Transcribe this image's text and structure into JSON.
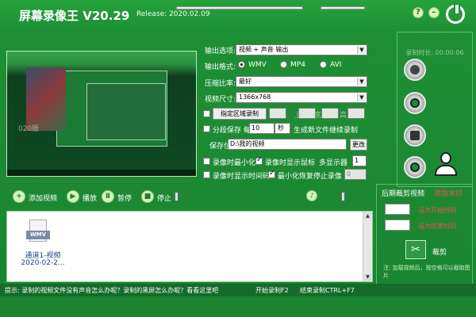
{
  "app": {
    "title": "屏幕录像王 V20.29",
    "release": "Release: 2020.02.09",
    "help_glyph": "?",
    "minimize_glyph": "–"
  },
  "preview": {
    "watermark": "020版"
  },
  "settings": {
    "output_option_label": "输出选项:",
    "output_option_value": "视频 + 声音 输出",
    "output_format_label": "输出格式:",
    "formats": [
      "WMV",
      "MP4",
      "AVI"
    ],
    "selected_format": "WMV",
    "compression_label": "压缩比率:",
    "compression_value": "最好",
    "size_label": "视频尺寸:",
    "size_value": "1366x768",
    "region_button": "指定区域录制",
    "region_left": "左",
    "region_top": "上",
    "region_width": "宽",
    "region_height": "高",
    "segment_label": "分段保存 每",
    "segment_value": "10",
    "segment_unit": "秒",
    "segment_suffix": "生成新文件继续录制",
    "save_label": "保存位置",
    "save_path": "D:\\我的视频",
    "change_button": "更改",
    "minimize_on_record": "录像时最小化",
    "show_cursor": "录像时显示鼠标",
    "multi_display": "多显示器",
    "multi_display_value": "1",
    "show_timecode": "录像时显示时间码",
    "minimize_restore_stop": "最小化恢复停止录像",
    "restore_value": "0"
  },
  "record_panel": {
    "time_label": "录制时长: 00:00:06"
  },
  "toolbar": {
    "add_video": "添加视频",
    "play": "播放",
    "pause": "暂停",
    "stop": "停止",
    "volume_icon": "♪"
  },
  "files": [
    {
      "tag": "WMV",
      "name": "通道1-视频",
      "date": "2020-02-2..."
    }
  ],
  "post_panel": {
    "edit_title": "后期裁剪视频",
    "watermark_title": "添加水印",
    "set_start": "设为开始时间",
    "set_end": "设为结束时间",
    "cut_label": "裁剪",
    "note": "注: 加载视频后，按空格可以截取图片"
  },
  "status": {
    "tip": "提示: 录制的视频文件没有声音怎么办呢？录制的黑屏怎么办呢？看看这里吧",
    "hotkey_start": "开始录制F2",
    "hotkey_stop": "结束录制CTRL+F7"
  },
  "colors": {
    "background": "#1e8f35",
    "accent_red": "#ff4d4d",
    "panel_border": "#5cbf6a"
  }
}
